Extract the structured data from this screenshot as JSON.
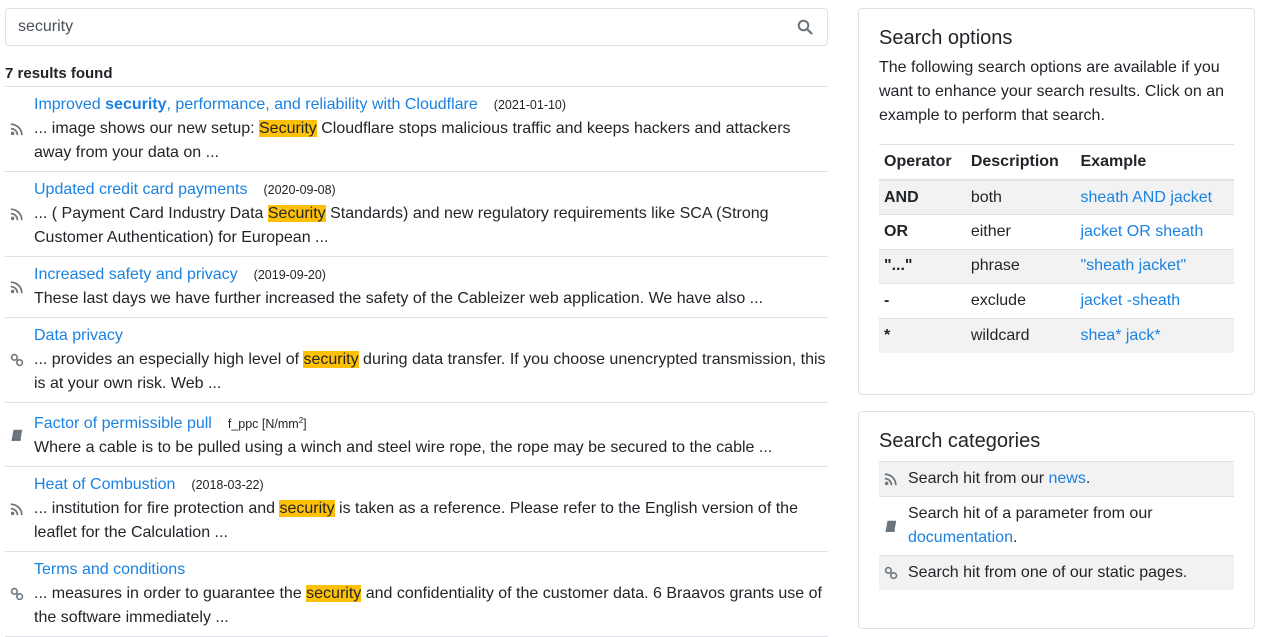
{
  "search": {
    "value": "security",
    "icon": "search-icon"
  },
  "results_count": "7 results found",
  "results": [
    {
      "icon": "rss-icon",
      "title_pre": "Improved ",
      "title_bold": "security",
      "title_post": ", performance, and reliability with Cloudflare",
      "meta": "(2021-01-10)",
      "snippet_pre": "... image shows our new setup: ",
      "snippet_hl": "Security",
      "snippet_post": " Cloudflare stops malicious traffic and keeps hackers and attackers away from your data on ..."
    },
    {
      "icon": "rss-icon",
      "title_pre": "Updated credit card payments",
      "title_bold": "",
      "title_post": "",
      "meta": "(2020-09-08)",
      "snippet_pre": "... ( Payment Card Industry Data ",
      "snippet_hl": "Security",
      "snippet_post": " Standards) and new regulatory requirements like SCA (Strong Customer Authentication) for European ..."
    },
    {
      "icon": "rss-icon",
      "title_pre": "Increased safety and privacy",
      "title_bold": "",
      "title_post": "",
      "meta": "(2019-09-20)",
      "snippet_pre": "These last days we have further increased the safety of the Cableizer web application. We have also ...",
      "snippet_hl": "",
      "snippet_post": ""
    },
    {
      "icon": "link-icon",
      "title_pre": "Data privacy",
      "title_bold": "",
      "title_post": "",
      "meta": "",
      "snippet_pre": "... provides an especially high level of ",
      "snippet_hl": "security",
      "snippet_post": " during data transfer. If you choose unencrypted transmission, this is at your own risk. Web ..."
    },
    {
      "icon": "book-icon",
      "title_pre": "Factor of permissible pull",
      "title_bold": "",
      "title_post": "",
      "meta": "f_ppc [N/mm",
      "meta_sup": "2",
      "meta_post": "]",
      "snippet_pre": "Where a cable is to be pulled using a winch and steel wire rope, the rope may be secured to the cable ...",
      "snippet_hl": "",
      "snippet_post": ""
    },
    {
      "icon": "rss-icon",
      "title_pre": "Heat of Combustion",
      "title_bold": "",
      "title_post": "",
      "meta": "(2018-03-22)",
      "snippet_pre": "... institution for fire protection and ",
      "snippet_hl": "security",
      "snippet_post": " is taken as a reference. Please refer to the English version of the leaflet for the Calculation ..."
    },
    {
      "icon": "link-icon",
      "title_pre": "Terms and conditions",
      "title_bold": "",
      "title_post": "",
      "meta": "",
      "snippet_pre": "... measures in order to guarantee the ",
      "snippet_hl": "security",
      "snippet_post": " and confidentiality of the customer data. 6 Braavos grants use of the software immediately ..."
    }
  ],
  "options": {
    "title": "Search options",
    "intro": "The following search options are available if you want to enhance your search results. Click on an example to perform that search.",
    "headers": [
      "Operator",
      "Description",
      "Example"
    ],
    "rows": [
      {
        "operator": "AND",
        "description": "both",
        "example": "sheath AND jacket"
      },
      {
        "operator": "OR",
        "description": "either",
        "example": "jacket OR sheath"
      },
      {
        "operator": "\"...\"",
        "description": "phrase",
        "example": "\"sheath jacket\""
      },
      {
        "operator": "-",
        "description": "exclude",
        "example": "jacket -sheath"
      },
      {
        "operator": "*",
        "description": "wildcard",
        "example": "shea* jack*"
      }
    ]
  },
  "categories": {
    "title": "Search categories",
    "items": [
      {
        "icon": "rss-icon",
        "text_pre": "Search hit from our ",
        "link": "news",
        "text_post": "."
      },
      {
        "icon": "book-icon",
        "text_pre": "Search hit of a parameter from our ",
        "link": "documentation",
        "text_post": "."
      },
      {
        "icon": "link-icon",
        "text_pre": "Search hit from one of our static pages.",
        "link": "",
        "text_post": ""
      }
    ]
  },
  "colors": {
    "link": "#1a82e2",
    "highlight": "#ffc107",
    "stripe": "#f2f2f2",
    "border": "#dee2e6"
  }
}
